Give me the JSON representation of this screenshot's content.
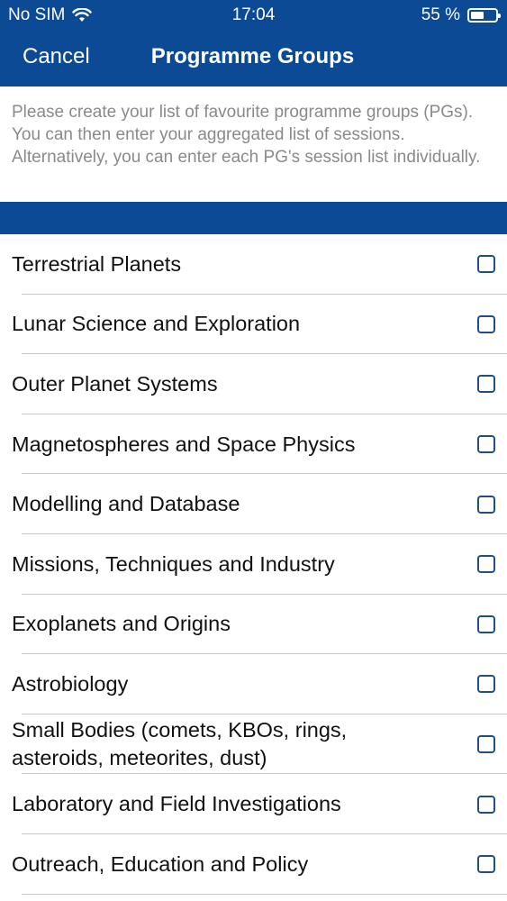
{
  "status_bar": {
    "carrier": "No SIM",
    "time": "17:04",
    "battery_text": "55 %",
    "battery_level": 0.55
  },
  "nav": {
    "cancel_label": "Cancel",
    "title": "Programme Groups"
  },
  "intro_text": "Please create your list of favourite programme groups (PGs). You can then enter your aggregated list of sessions. Alternatively, you can enter each PG's session list individually.",
  "colors": {
    "brand_blue": "#0c4a96",
    "intro_text": "#8a8a8a",
    "checkbox_border": "#1f4e85"
  },
  "groups": [
    {
      "label": "Terrestrial Planets",
      "checked": false
    },
    {
      "label": "Lunar Science and Exploration",
      "checked": false
    },
    {
      "label": "Outer Planet Systems",
      "checked": false
    },
    {
      "label": "Magnetospheres and Space Physics",
      "checked": false
    },
    {
      "label": "Modelling and Database",
      "checked": false
    },
    {
      "label": "Missions, Techniques and Industry",
      "checked": false
    },
    {
      "label": "Exoplanets and Origins",
      "checked": false
    },
    {
      "label": "Astrobiology",
      "checked": false
    },
    {
      "label": "Small Bodies (comets, KBOs, rings, asteroids, meteorites, dust)",
      "checked": false
    },
    {
      "label": "Laboratory and Field Investigations",
      "checked": false
    },
    {
      "label": "Outreach, Education and Policy",
      "checked": false
    }
  ]
}
